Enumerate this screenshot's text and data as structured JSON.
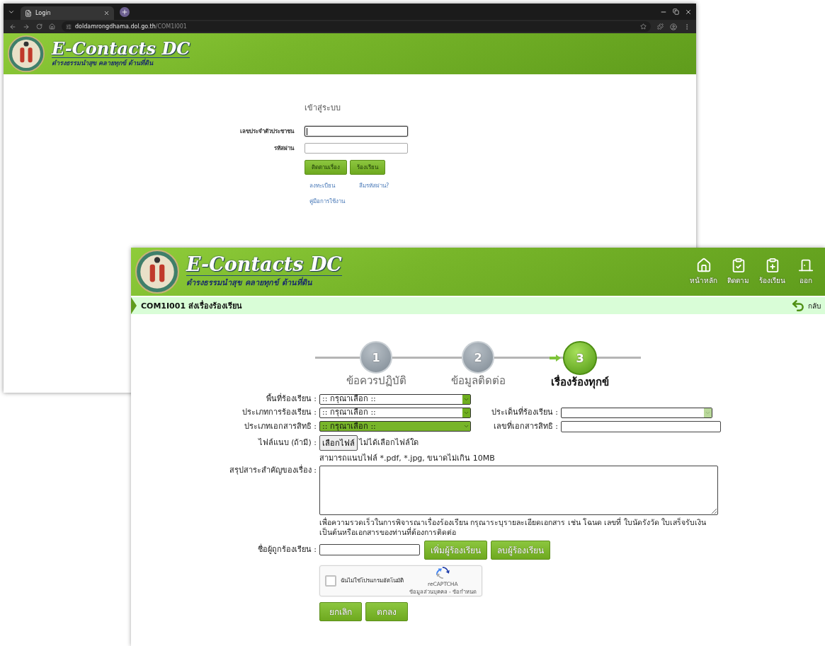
{
  "login_window": {
    "tab_title": "Login",
    "url_host": "doldamrongdhama.dol.go.th",
    "url_path": "/COM1I001",
    "brand": {
      "title": "E-Contacts DC",
      "subtitle": "ดำรงธรรมนำสุข คลายทุกข์ ด้านที่ดิน"
    },
    "heading": "เข้าสู่ระบบ",
    "fields": [
      {
        "label": "เลขประจำตัวประชาชน",
        "focused": true
      },
      {
        "label": "รหัสผ่าน",
        "focused": false
      }
    ],
    "buttons": [
      "ติดตามเรื่อง",
      "ร้องเรียน"
    ],
    "links": [
      "ลงทะเบียน",
      "ลืมรหัสผ่าน?",
      "คู่มือการใช้งาน"
    ]
  },
  "complaint_window": {
    "brand": {
      "title": "E-Contacts DC",
      "subtitle": "ดำรงธรรมนำสุข คลายทุกข์ ด้านที่ดิน"
    },
    "nav": [
      {
        "label": "หน้าหลัก"
      },
      {
        "label": "ติดตาม"
      },
      {
        "label": "ร้องเรียน"
      },
      {
        "label": "ออก"
      }
    ],
    "page_title": "COM1I001 ส่งเรื่องร้องเรียน",
    "back": "กลับ",
    "steps": [
      {
        "number": "1",
        "label": "ข้อควรปฏิบัติ",
        "selected": false
      },
      {
        "number": "2",
        "label": "ข้อมูลติดต่อ",
        "selected": false
      },
      {
        "number": "3",
        "label": "เรื่องร้องทุกข์",
        "selected": true
      }
    ],
    "rows": [
      [
        {
          "label": "พื้นที่ร้องเรียน :",
          "kind": "select",
          "value": ":: กรุณาเลือก ::",
          "highlighted": false,
          "disabled": false
        }
      ],
      [
        {
          "label": "ประเภทการร้องเรียน :",
          "kind": "select",
          "value": ":: กรุณาเลือก ::",
          "highlighted": false,
          "disabled": false
        },
        {
          "label": "ประเด็นที่ร้องเรียน :",
          "kind": "select",
          "highlighted": false,
          "disabled": true
        }
      ],
      [
        {
          "label": "ประเภทเอกสารสิทธิ :",
          "kind": "select",
          "value": ":: กรุณาเลือก ::",
          "highlighted": true,
          "disabled": false
        },
        {
          "label": "เลขที่เอกสารสิทธิ :",
          "kind": "text"
        }
      ],
      [
        {
          "label": "ไฟล์แนบ (ถ้ามี) :",
          "kind": "file",
          "button": "เลือกไฟล์",
          "status": "ไม่ได้เลือกไฟล์ใด"
        }
      ]
    ],
    "file_hint": "สามารถแนบไฟล์ *.pdf, *.jpg, ขนาดไม่เกิน 10MB",
    "summary": {
      "label": "สรุปสาระสำคัญของเรื่อง :",
      "note": "เพื่อความรวดเร็วในการพิจารณาเรื่องร้องเรียน กรุณาระบุรายละเอียดเอกสาร เช่น โฉนด เลขที่ ใบนัดรังวัด ใบเสร็จรับเงิน เป็นต้นหรือเอกสารของท่านที่ต้องการติดต่อ"
    },
    "respondent": {
      "label": "ชื่อผู้ถูกร้องเรียน :",
      "buttons": [
        "เพิ่มผู้ร้องเรียน",
        "ลบผู้ร้องเรียน"
      ]
    },
    "captcha": {
      "checked": false,
      "label": "ฉันไม่ใช่โปรแกรมอัตโนมัติ",
      "brand": "reCAPTCHA",
      "links": "ข้อมูลส่วนบุคคล - ข้อกำหนด"
    },
    "actions": [
      "ยกเลิก",
      "ตกลง"
    ]
  }
}
